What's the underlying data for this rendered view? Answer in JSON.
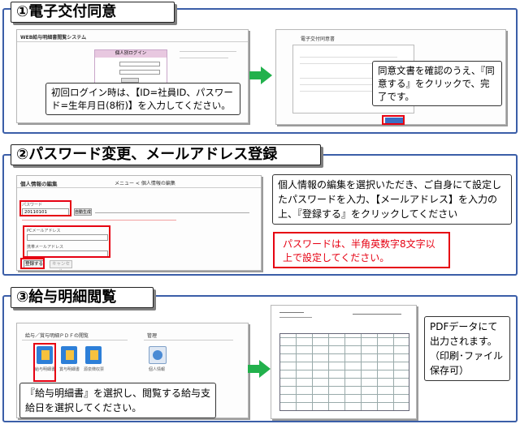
{
  "section1": {
    "title": "①電子交付同意",
    "login_screen": {
      "system_name": "WEB給与明細書閲覧システム",
      "login_panel_title": "個人別ログイン"
    },
    "callout_login": "初回ログイン時は、【ID=社員ID、パスワード=生年月日(8桁)】を入力してください。",
    "consent_screen": {
      "doc_title": "電子交付同意書"
    },
    "callout_consent": "同意文書を確認のうえ、『同意する』をクリックで、完了です。"
  },
  "section2": {
    "title": "②パスワード変更、メールアドレス登録",
    "edit_screen": {
      "heading": "個人情報の編集",
      "breadcrumb": "メニュー < 個人情報の編集",
      "password_label": "パスワード",
      "password_value": "20110101",
      "auto_generate_button": "自動生成",
      "pc_mail_label": "PCメールアドレス",
      "mobile_mail_label": "携帯メールアドレス",
      "register_button": "登録する",
      "cancel_button": "キャンセル"
    },
    "callout_edit": "個人情報の編集を選択いただき、ご自身にて設定したパスワードを入力、【メールアドレス】を入力の上、『登録する』をクリックしてください",
    "warning": "パスワードは、半角英数字8文字以上で設定してください。"
  },
  "section3": {
    "title": "③給与明細閲覧",
    "menu_screen": {
      "heading": "給与／賞与明細ＰＤＦの閲覧",
      "admin_heading": "管理",
      "icon_labels": [
        "給与明細書",
        "賞与明細書",
        "源泉徴収票",
        "個人情報"
      ]
    },
    "callout_select": "『給与明細書』を選択し、閲覧する給与支給日を選択してください。",
    "callout_pdf": "PDFデータにて出力されます。（印刷･ファイル保存可）"
  },
  "colors": {
    "frame": "#3b5ea8",
    "highlight": "#e60012",
    "arrow": "#22b14c"
  }
}
